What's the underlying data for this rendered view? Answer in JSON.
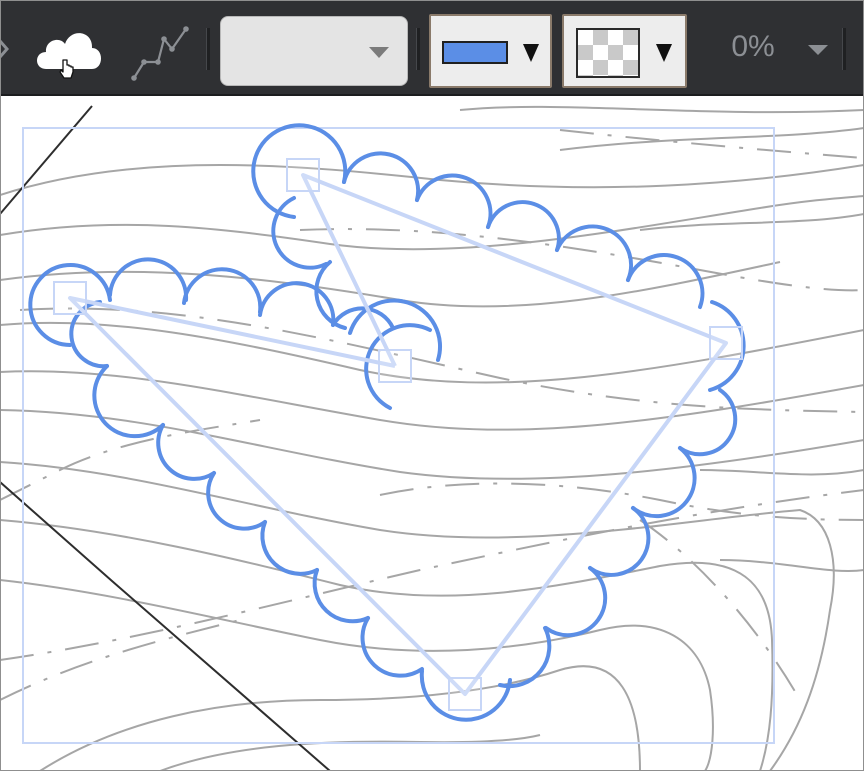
{
  "toolbar": {
    "tools": [
      {
        "name": "cloud-tool",
        "icon": "cloud-icon"
      },
      {
        "name": "polyline-tool",
        "icon": "polyline-icon"
      }
    ],
    "style_dropdown": {
      "value": ""
    },
    "stroke_color": {
      "icon": "stroke-color-swatch",
      "color": "#5b8ee6"
    },
    "fill_color": {
      "icon": "transparent-checker-swatch"
    },
    "opacity": {
      "value": "0%"
    }
  },
  "colors": {
    "toolbar_bg": "#2f3033",
    "annotation_stroke": "#5b8ee6",
    "selection": "#c7d6f7",
    "contour": "#a6a6a6"
  }
}
